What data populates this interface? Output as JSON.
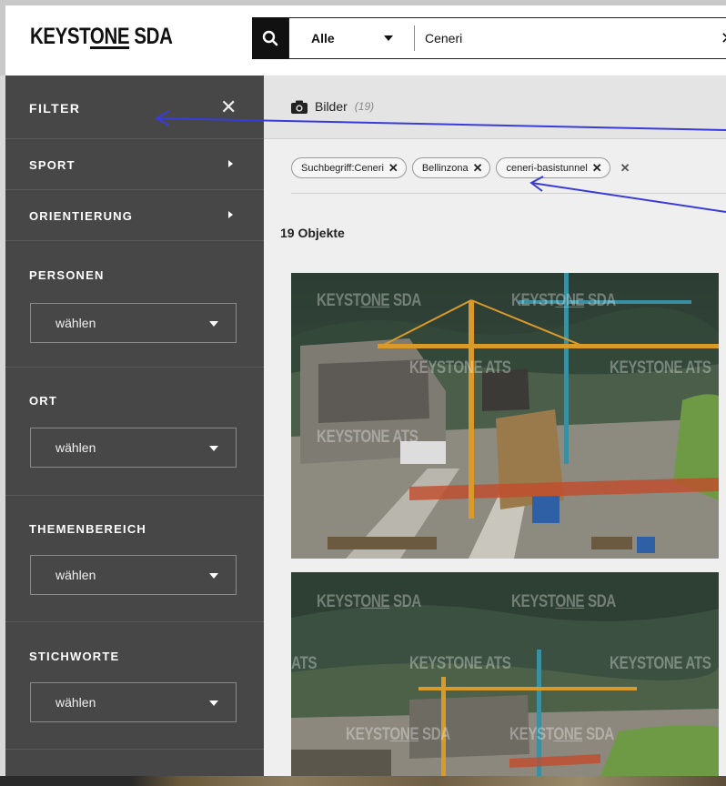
{
  "header": {
    "logo_pre": "KEYST",
    "logo_u": "ONE",
    "logo_post": " SDA",
    "search_category": "Alle",
    "search_value": "Ceneri"
  },
  "sidebar": {
    "title": "FILTER",
    "rows": [
      {
        "label": "SPORT"
      },
      {
        "label": "ORIENTIERUNG"
      }
    ],
    "groups": [
      {
        "label": "PERSONEN",
        "value": "wählen"
      },
      {
        "label": "ORT",
        "value": "wählen"
      },
      {
        "label": "THEMENBEREICH",
        "value": "wählen"
      },
      {
        "label": "STICHWORTE",
        "value": "wählen"
      }
    ]
  },
  "main": {
    "tab_label": "Bilder",
    "tab_count": "(19)",
    "chips": [
      {
        "label": "Suchbegriff:Ceneri"
      },
      {
        "label": "Bellinzona"
      },
      {
        "label": "ceneri-basistunnel"
      }
    ],
    "object_count": "19 Objekte"
  },
  "watermarks": {
    "keystone_pre": "KEYST",
    "keystone_u": "ONE",
    "keystone_post": " SDA",
    "ats": "KEYSTONE ATS",
    "ats_short": "ATS"
  },
  "colors": {
    "sidebar_bg": "#474747",
    "annotation_arrow": "#3b3bdc"
  },
  "icons": {
    "search": "search-icon",
    "camera": "camera-icon",
    "close": "close-icon"
  }
}
